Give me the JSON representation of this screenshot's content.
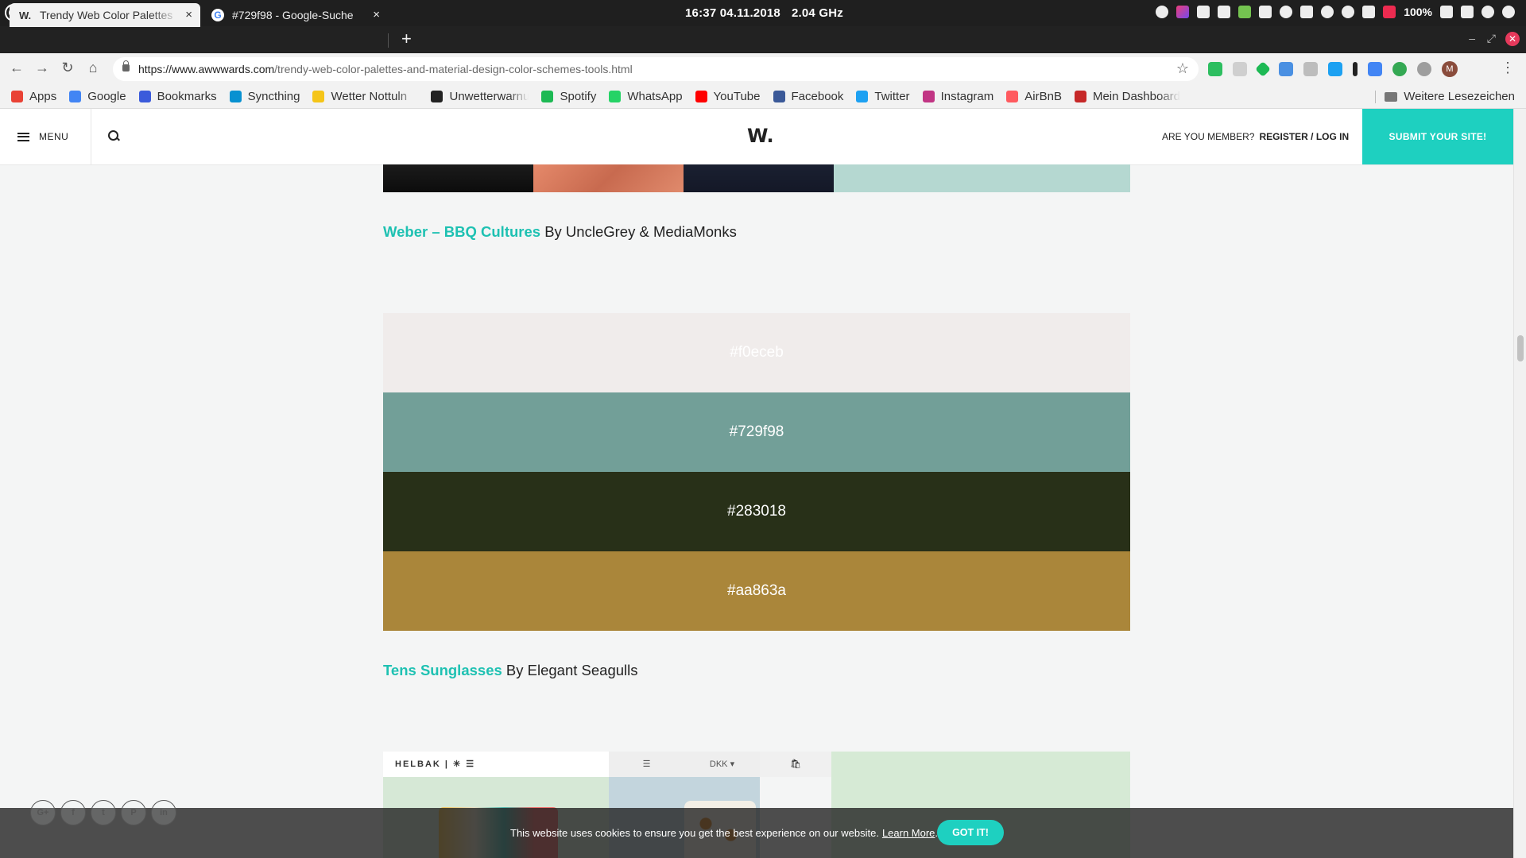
{
  "os": {
    "clock": "16:37 04.11.2018",
    "cpu": "2.04 GHz",
    "battery": "100%"
  },
  "tabs": [
    {
      "favicon": "W.",
      "title": "Trendy Web Color Palettes",
      "close": "×"
    },
    {
      "favicon": "G",
      "title": "#729f98 - Google-Suche",
      "close": "×"
    }
  ],
  "newtab": "+",
  "window": {
    "minimize": "–",
    "maximize": "⤢",
    "close": "✕"
  },
  "addressbar": {
    "url_domain": "https://www.awwwards.com",
    "url_path": "/trendy-web-color-palettes-and-material-design-color-schemes-tools.html",
    "avatar": "M"
  },
  "bookmarks": [
    {
      "label": "Apps",
      "color": "#e94235"
    },
    {
      "label": "Google",
      "color": "#4285f4"
    },
    {
      "label": "Bookmarks",
      "color": "#3b5bdb"
    },
    {
      "label": "Syncthing",
      "color": "#0891d1"
    },
    {
      "label": "Wetter Nottuln",
      "color": "#f5c518"
    },
    {
      "label": "Unwetterwarnu",
      "color": "#222222"
    },
    {
      "label": "Spotify",
      "color": "#1db954"
    },
    {
      "label": "WhatsApp",
      "color": "#25d366"
    },
    {
      "label": "YouTube",
      "color": "#ff0000"
    },
    {
      "label": "Facebook",
      "color": "#3b5998"
    },
    {
      "label": "Twitter",
      "color": "#1da1f2"
    },
    {
      "label": "Instagram",
      "color": "#c13584"
    },
    {
      "label": "AirBnB",
      "color": "#ff5a5f"
    },
    {
      "label": "Mein Dashboard",
      "color": "#c62828"
    }
  ],
  "bookmarks_more": "Weitere Lesezeichen",
  "site": {
    "menu": "MENU",
    "brand": "W.",
    "member_q": "ARE YOU MEMBER?",
    "register": "REGISTER / LOG IN",
    "submit": "SUBMIT YOUR SITE!"
  },
  "palette1": {
    "link": "Weber – BBQ Cultures",
    "by": " By UncleGrey & MediaMonks"
  },
  "palette2": {
    "colors": [
      {
        "hex": "#f0eceb",
        "label": "#f0eceb",
        "text": "#ffffff"
      },
      {
        "hex": "#729f98",
        "label": "#729f98",
        "text": "#ffffff"
      },
      {
        "hex": "#283018",
        "label": "#283018",
        "text": "#ffffff"
      },
      {
        "hex": "#aa863a",
        "label": "#aa863a",
        "text": "#ffffff"
      }
    ],
    "link": "Tens Sunglasses",
    "by": " By Elegant Seagulls"
  },
  "next_preview": {
    "logo_text": "HELBAK | ✳ ☰",
    "menu": "☰",
    "dkk": "DKK ▾",
    "bag": "🛍"
  },
  "social": [
    "G+",
    "f",
    "t",
    "P",
    "in"
  ],
  "cookie": {
    "text": "This website uses cookies to ensure you get the best experience on our website.",
    "learn": "Learn More",
    "dot": ".",
    "got_it": "GOT IT!"
  }
}
